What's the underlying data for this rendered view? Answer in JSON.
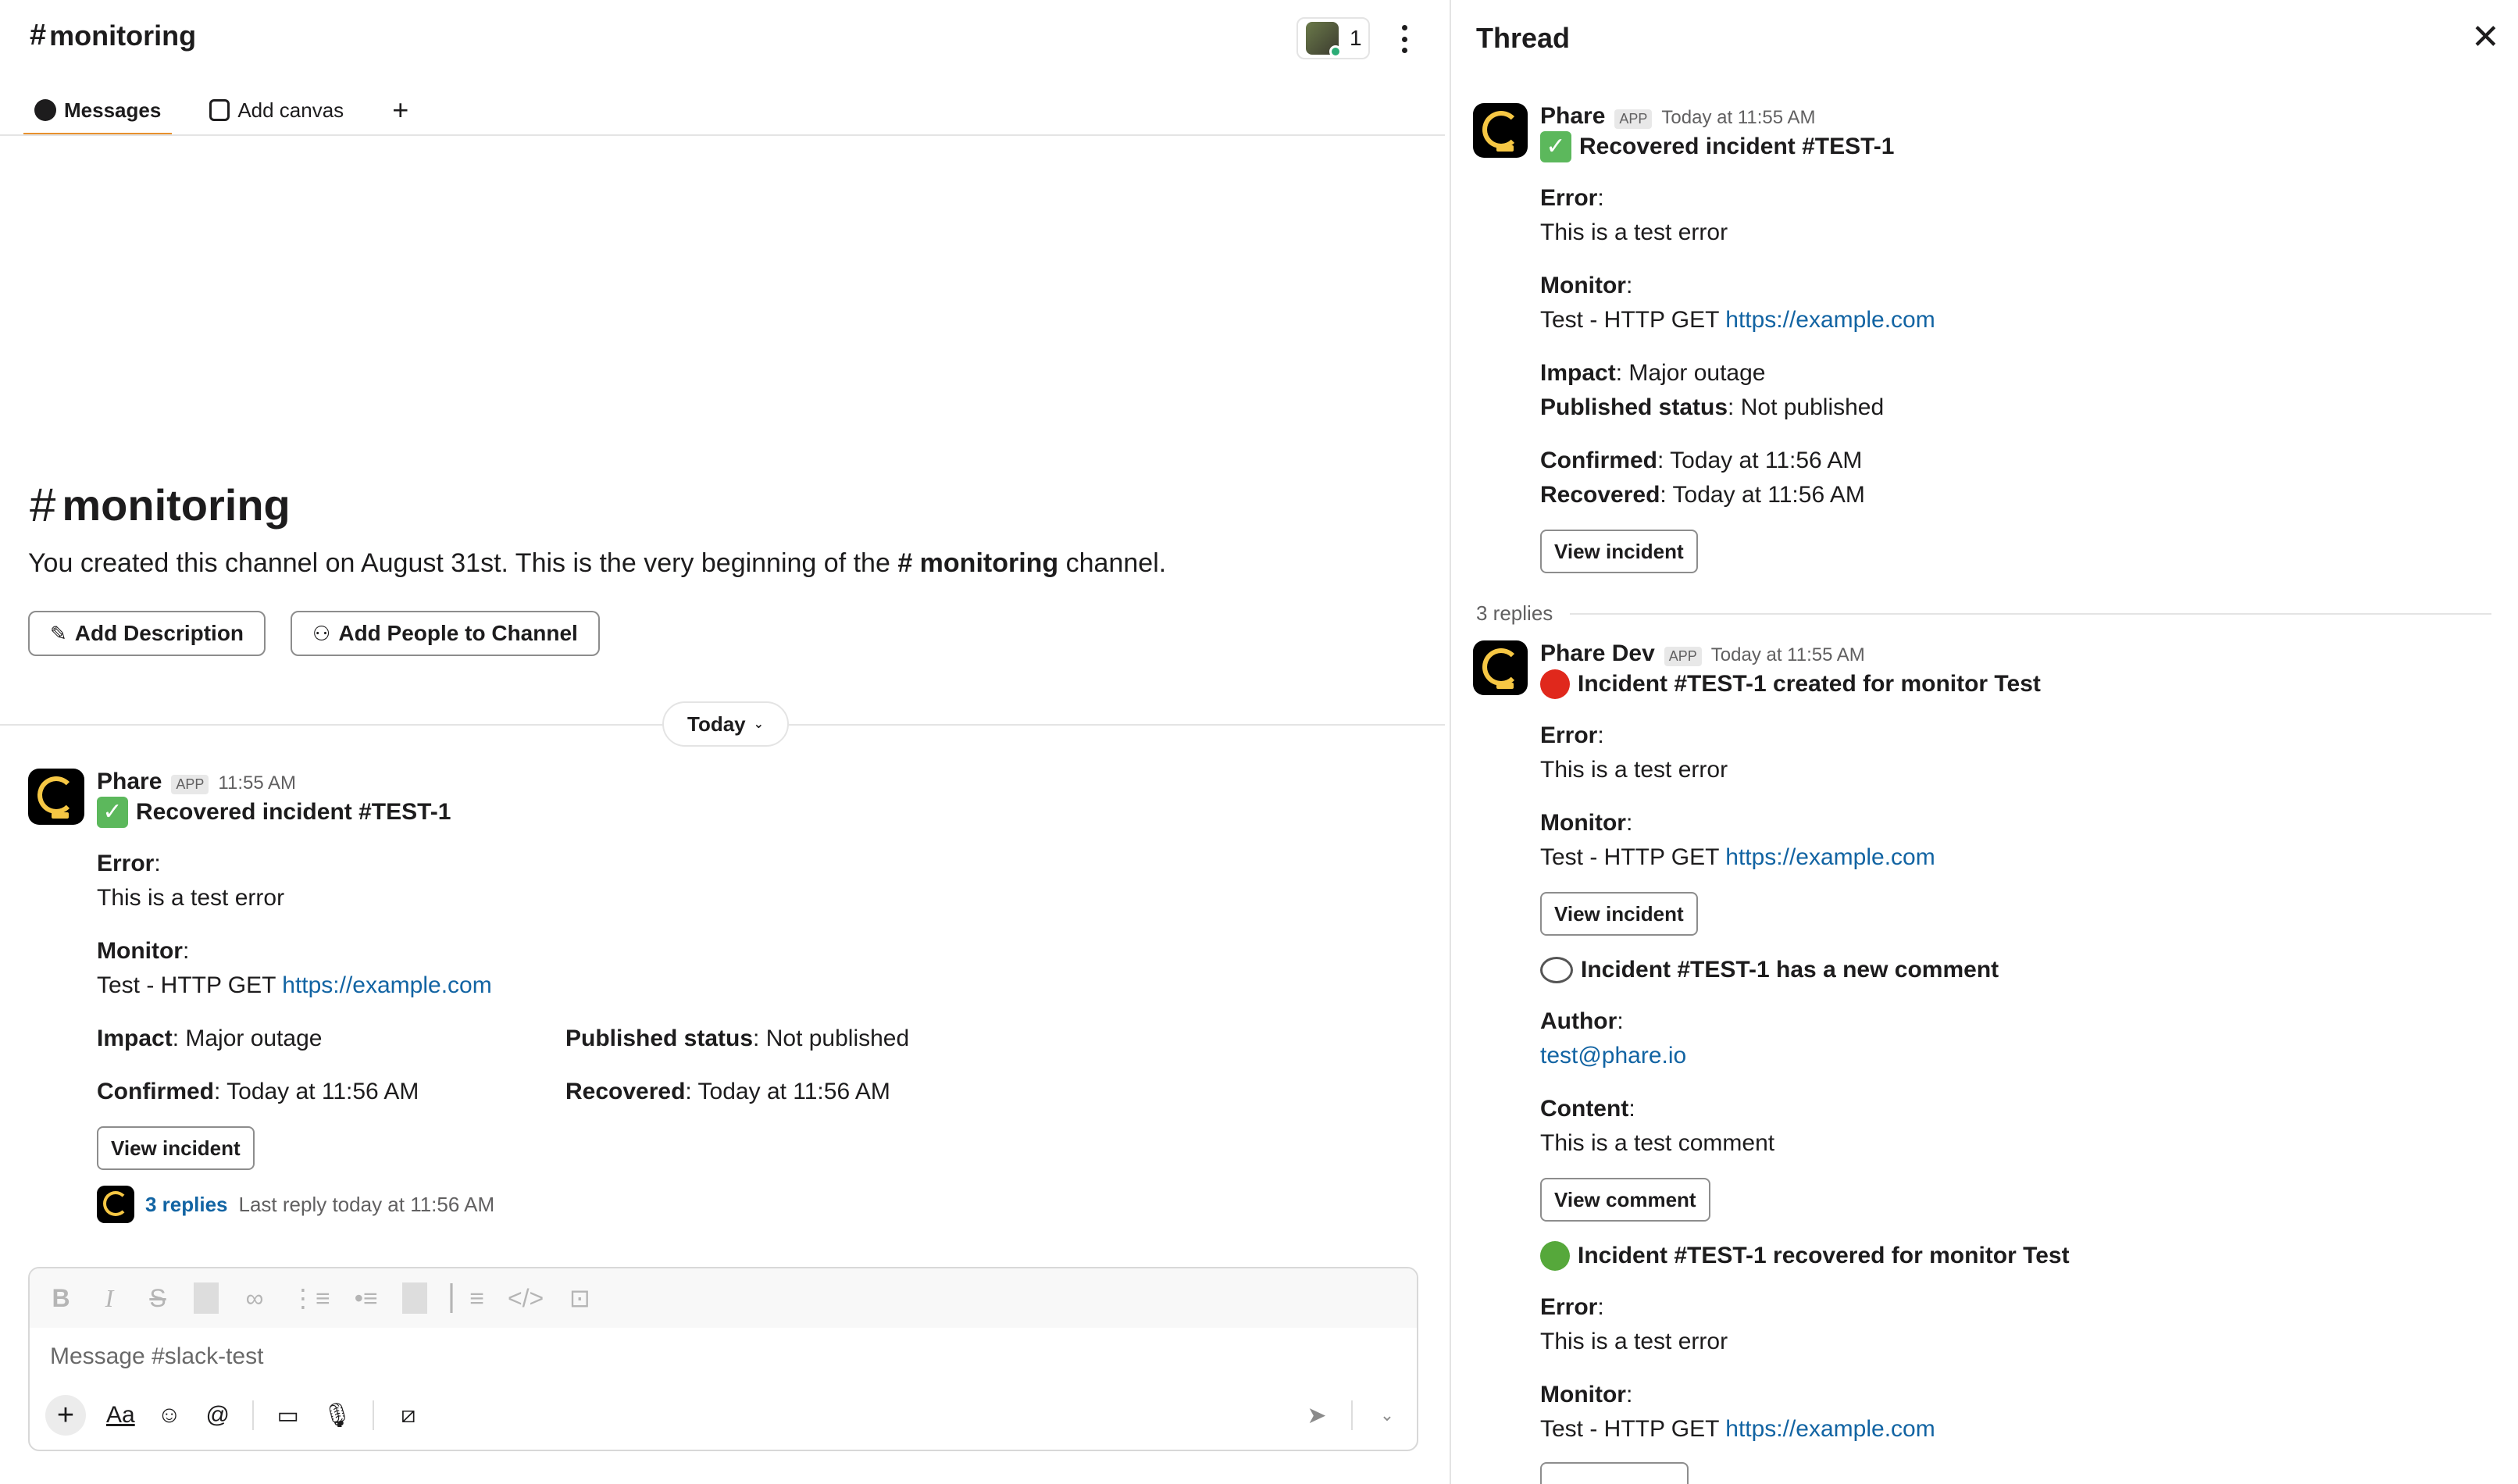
{
  "channel": {
    "name": "monitoring",
    "members_count": "1",
    "tabs": [
      {
        "label": "Messages",
        "active": true
      },
      {
        "label": "Add canvas",
        "active": false
      }
    ],
    "intro": {
      "title": "monitoring",
      "text_before": "You created this channel on August 31st. This is the very beginning of the ",
      "channel_ref": "monitoring",
      "text_after": " channel.",
      "add_description": "Add Description",
      "add_people": "Add People to Channel"
    },
    "day_divider": "Today",
    "message": {
      "author": "Phare",
      "badge": "APP",
      "time": "11:55 AM",
      "title": "Recovered incident #TEST-1",
      "error_label": "Error",
      "error_value": "This is a test error",
      "monitor_label": "Monitor",
      "monitor_text": "Test - HTTP GET ",
      "monitor_link": "https://example.com",
      "impact_label": "Impact",
      "impact_value": ": Major outage",
      "published_label": "Published status",
      "published_value": ": Not published",
      "confirmed_label": "Confirmed",
      "confirmed_value": ": Today at 11:56 AM",
      "recovered_label": "Recovered",
      "recovered_value": ": Today at 11:56 AM",
      "button": "View incident",
      "replies_link": "3 replies",
      "last_reply": "Last reply today at 11:56 AM"
    },
    "composer": {
      "placeholder": "Message #slack-test"
    }
  },
  "thread": {
    "title": "Thread",
    "parent": {
      "author": "Phare",
      "badge": "APP",
      "time": "Today at 11:55 AM",
      "title": "Recovered incident #TEST-1",
      "error_label": "Error",
      "error_value": "This is a test error",
      "monitor_label": "Monitor",
      "monitor_text": "Test - HTTP GET ",
      "monitor_link": "https://example.com",
      "impact_label": "Impact",
      "impact_value": ": Major outage",
      "published_label": "Published status",
      "published_value": ": Not published",
      "confirmed_label": "Confirmed",
      "confirmed_value": ": Today at 11:56 AM",
      "recovered_label": "Recovered",
      "recovered_value": ": Today at 11:56 AM",
      "button": "View incident"
    },
    "replies_count": "3 replies",
    "reply": {
      "author": "Phare Dev",
      "badge": "APP",
      "time": "Today at 11:55 AM",
      "created_title": "Incident #TEST-1 created for monitor Test",
      "error_label": "Error",
      "error_value": "This is a test error",
      "monitor_label": "Monitor",
      "monitor_text": "Test - HTTP GET ",
      "monitor_link": "https://example.com",
      "view_incident": "View incident",
      "comment_title": "Incident #TEST-1 has a new comment",
      "author_label": "Author",
      "author_value": "test@phare.io",
      "content_label": "Content",
      "content_value": "This is a test comment",
      "view_comment": "View comment",
      "recovered_title": "Incident #TEST-1 recovered for monitor Test",
      "error2_label": "Error",
      "error2_value": "This is a test error",
      "monitor2_label": "Monitor",
      "monitor2_text": "Test - HTTP GET ",
      "monitor2_link": "https://example.com"
    }
  },
  "colors": {
    "link": "#1264a3",
    "tab_accent": "#e8912d",
    "app_logo_ring": "#f6c744"
  },
  "icons": [
    "close-icon",
    "kebab-menu-icon",
    "plus-icon",
    "pencil-icon",
    "add-person-icon",
    "check-emoji-icon",
    "red-circle-emoji-icon",
    "green-circle-emoji-icon",
    "speech-bubble-emoji-icon",
    "send-icon"
  ]
}
